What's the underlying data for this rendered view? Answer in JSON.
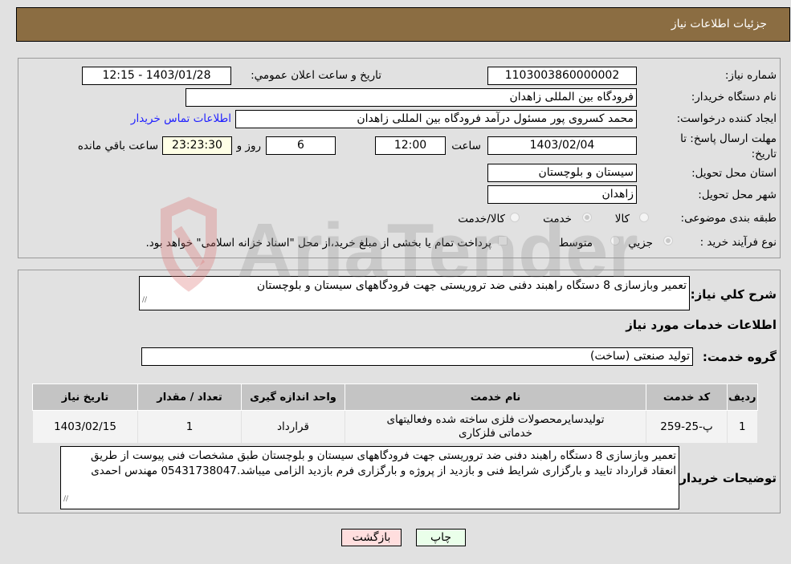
{
  "header": {
    "title": "جزئیات اطلاعات نیاز"
  },
  "form": {
    "need_number_label": "شماره نیاز:",
    "need_number": "1103003860000002",
    "announce_label": "تاریخ و ساعت اعلان عمومي:",
    "announce_value": "1403/01/28 - 12:15",
    "buyer_org_label": "نام دستگاه خریدار:",
    "buyer_org": "فرودگاه بین المللی زاهدان",
    "creator_label": "ایجاد کننده درخواست:",
    "creator": "محمد کسروی پور مسئول درآمد فرودگاه بین المللی زاهدان",
    "contact_link": "اطلاعات تماس خریدار",
    "deadline_label": "مهلت ارسال پاسخ: تا تاریخ:",
    "deadline_date": "1403/02/04",
    "time_label": "ساعت",
    "deadline_time": "12:00",
    "days": "6",
    "days_label": "روز و",
    "remaining_time": "23:23:30",
    "remaining_label": "ساعت باقي مانده",
    "province_label": "استان محل تحویل:",
    "province": "سیستان و بلوچستان",
    "city_label": "شهر محل تحویل:",
    "city": "زاهدان",
    "category_label": "طبقه بندی موضوعی:",
    "category_options": [
      {
        "label": "کالا",
        "selected": false
      },
      {
        "label": "خدمت",
        "selected": true
      },
      {
        "label": "کالا/خدمت",
        "selected": false
      }
    ],
    "process_label": "نوع فرآیند خرید :",
    "process_options": [
      {
        "label": "جزیي",
        "selected": true
      },
      {
        "label": "متوسط",
        "selected": false
      }
    ],
    "treasury_note": "پرداخت تمام یا بخشی از مبلغ خرید،از محل \"اسناد خزانه اسلامی\" خواهد بود."
  },
  "details": {
    "summary_label": "شرح کلي نیاز:",
    "summary": "تعمیر وبازسازی 8 دستگاه راهبند دفنی ضد تروریستی جهت فرودگاههای سیستان و بلوچستان",
    "services_heading": "اطلاعات خدمات مورد نیاز",
    "service_group_label": "گروه خدمت:",
    "service_group": "تولید صنعتی (ساخت)",
    "table": {
      "headers": [
        "ردیف",
        "کد خدمت",
        "نام خدمت",
        "واحد اندازه گیری",
        "تعداد / مقدار",
        "تاریخ نیاز"
      ],
      "rows": [
        [
          "1",
          "پ-25-259",
          "تولیدسایرمحصولات فلزی ساخته شده وفعالیتهای خدماتی فلزکاری",
          "قرارداد",
          "1",
          "1403/02/15"
        ]
      ]
    },
    "buyer_notes_label": "توضیحات خریدار:",
    "buyer_notes": "تعمیر وبازسازی 8 دستگاه راهبند دفنی ضد تروریستی جهت فرودگاههای سیستان و بلوچستان طبق مشخصات فنی پیوست از طریق انعقاد قرارداد تایید و بارگزاری شرایط فنی و بازدید از پروژه و بارگزاری فرم بازدید الزامی میباشد.05431738047 مهندس احمدی"
  },
  "buttons": {
    "print": "چاپ",
    "back": "بازگشت"
  },
  "watermark": {
    "text": "AriaTender.neT"
  },
  "colors": {
    "header": "#8b6d42",
    "print_bg": "#eaffea",
    "back_bg": "#ffdede",
    "link": "#2020ff"
  }
}
